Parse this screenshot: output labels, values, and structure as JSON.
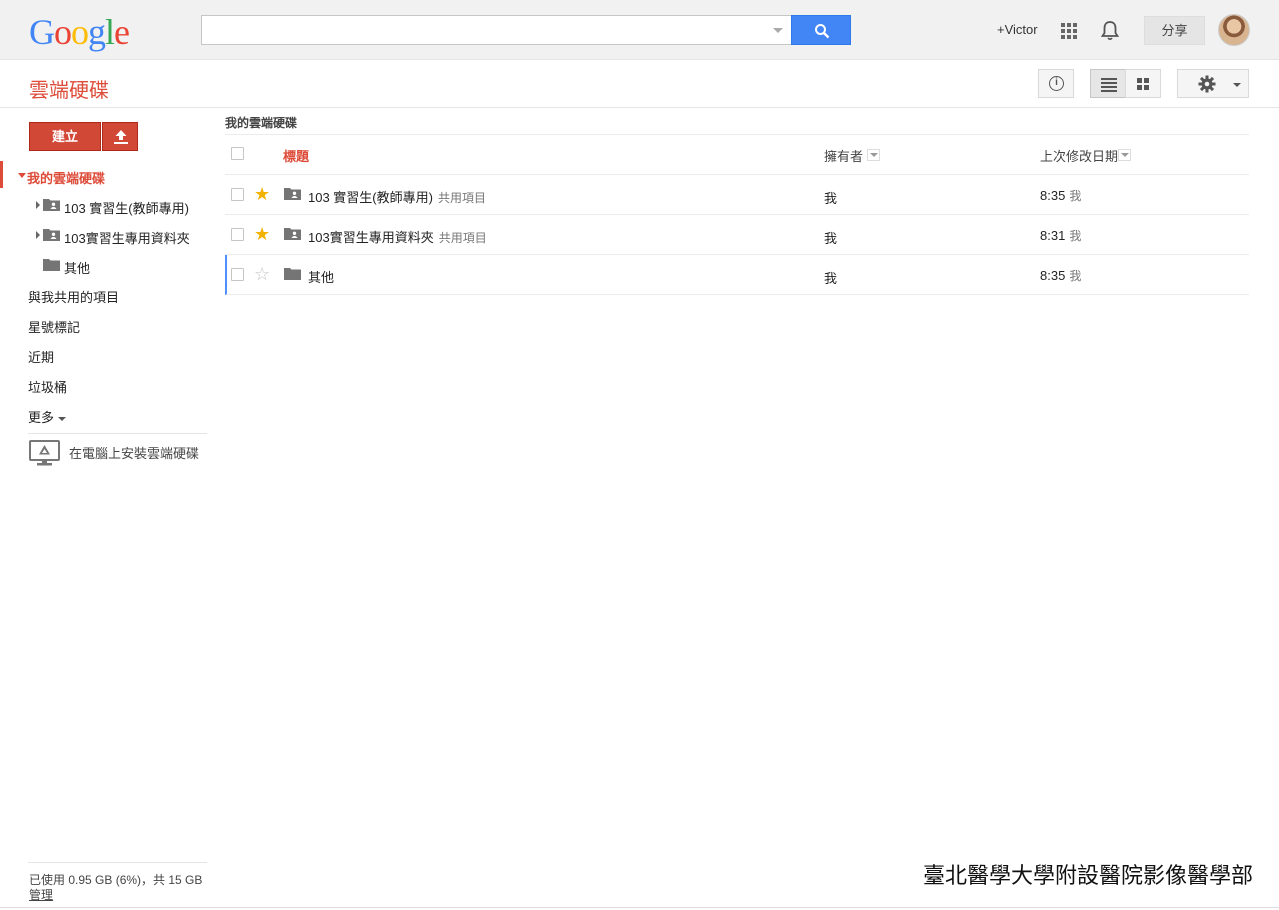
{
  "header": {
    "logo_letters": [
      "G",
      "o",
      "o",
      "g",
      "l",
      "e"
    ],
    "search_value": "",
    "plus_user": "+Victor",
    "share_label": "分享"
  },
  "appbar": {
    "title": "雲端硬碟",
    "info_icon": "i"
  },
  "sidebar": {
    "create_label": "建立",
    "my_drive": "我的雲端硬碟",
    "tree": [
      {
        "label": "103 實習生(教師專用)",
        "icon": "shared-folder-icon",
        "expandable": true
      },
      {
        "label": "103實習生專用資料夾",
        "icon": "shared-folder-icon",
        "expandable": true
      },
      {
        "label": "其他",
        "icon": "folder-icon",
        "expandable": false
      }
    ],
    "items": [
      "與我共用的項目",
      "星號標記",
      "近期",
      "垃圾桶",
      "更多"
    ],
    "install_label": "在電腦上安裝雲端硬碟",
    "storage": "已使用 0.95 GB (6%)，共 15 GB",
    "manage": "管理"
  },
  "main": {
    "breadcrumb": "我的雲端硬碟",
    "columns": {
      "title": "標題",
      "owner": "擁有者",
      "modified": "上次修改日期"
    },
    "rows": [
      {
        "name": "103 實習生(教師專用)",
        "shared": "共用項目",
        "owner": "我",
        "time": "8:35",
        "by": "我",
        "starred": true,
        "icon": "shared-folder-icon"
      },
      {
        "name": "103實習生專用資料夾",
        "shared": "共用項目",
        "owner": "我",
        "time": "8:31",
        "by": "我",
        "starred": true,
        "icon": "shared-folder-icon"
      },
      {
        "name": "其他",
        "shared": "",
        "owner": "我",
        "time": "8:35",
        "by": "我",
        "starred": false,
        "icon": "folder-icon"
      }
    ]
  },
  "watermark": "臺北醫學大學附設醫院影像醫學部",
  "colors": {
    "accent_red": "#dd4b39",
    "search_blue": "#4285f4",
    "star_yellow": "#f2b300"
  }
}
